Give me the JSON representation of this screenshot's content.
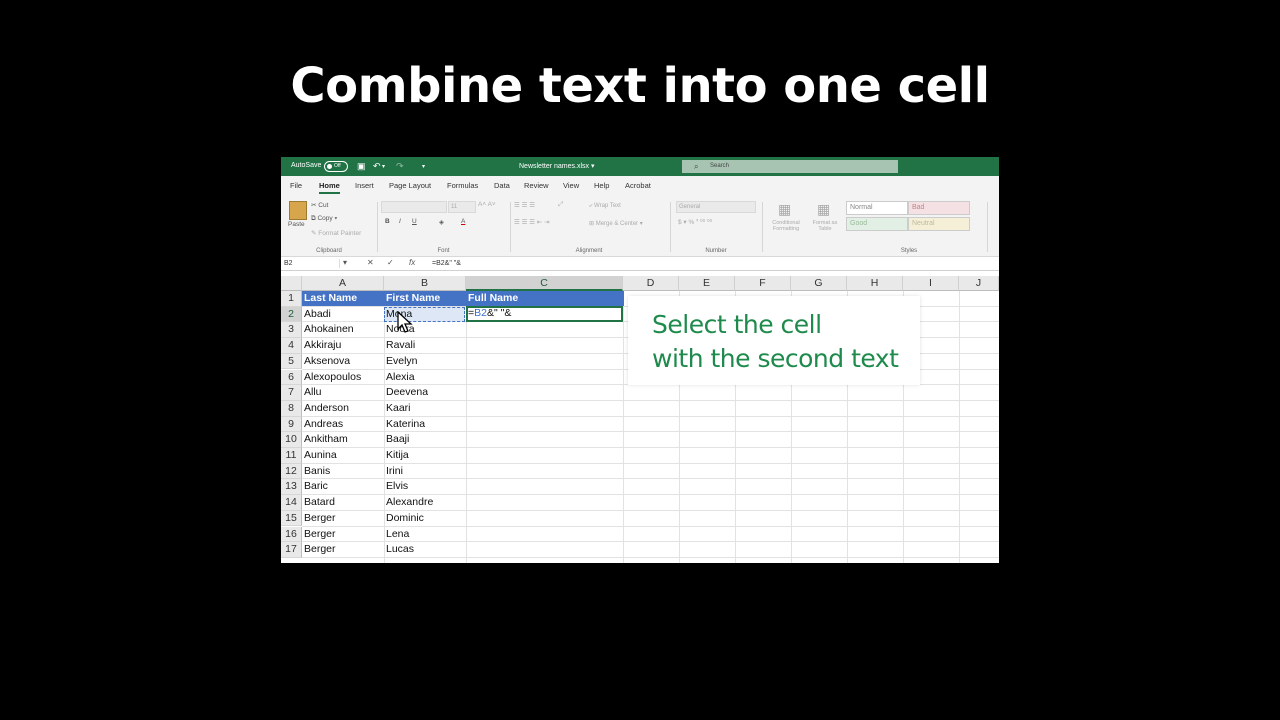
{
  "headline": "Combine text into one cell",
  "titlebar": {
    "autosave": "AutoSave",
    "toggle": "Off",
    "filename": "Newsletter names.xlsx ▾",
    "search_placeholder": "Search"
  },
  "menu": [
    "File",
    "Home",
    "Insert",
    "Page Layout",
    "Formulas",
    "Data",
    "Review",
    "View",
    "Help",
    "Acrobat"
  ],
  "ribbon": {
    "clipboard": {
      "paste": "Paste",
      "cut": "Cut",
      "copy": "Copy",
      "format_painter": "Format Painter",
      "label": "Clipboard"
    },
    "font": {
      "label": "Font",
      "size": "11"
    },
    "alignment": {
      "wrap": "Wrap Text",
      "merge": "Merge & Center",
      "label": "Alignment"
    },
    "number": {
      "format": "General",
      "label": "Number"
    },
    "conditional": "Conditional Formatting",
    "format_as_table": "Format as Table",
    "styles": {
      "normal": "Normal",
      "bad": "Bad",
      "good": "Good",
      "neutral": "Neutral",
      "label": "Styles"
    }
  },
  "formula_bar": {
    "name_box": "B2",
    "cancel": "✕",
    "enter": "✓",
    "fx": "fx",
    "formula": "=B2&\" \"&"
  },
  "columns": [
    "A",
    "B",
    "C",
    "D",
    "E",
    "F",
    "G",
    "H",
    "I",
    "J"
  ],
  "rows": [
    [
      "Last Name",
      "First Name",
      "Full Name"
    ],
    [
      "Abadi",
      "Mona",
      ""
    ],
    [
      "Ahokainen",
      "Noora",
      ""
    ],
    [
      "Akkiraju",
      "Ravali",
      ""
    ],
    [
      "Aksenova",
      "Evelyn",
      ""
    ],
    [
      "Alexopoulos",
      "Alexia",
      ""
    ],
    [
      "Allu",
      "Deevena",
      ""
    ],
    [
      "Anderson",
      "Kaari",
      ""
    ],
    [
      "Andreas",
      "Katerina",
      ""
    ],
    [
      "Ankitham",
      "Baaji",
      ""
    ],
    [
      "Aunina",
      "Kitija",
      ""
    ],
    [
      "Banis",
      "Irini",
      ""
    ],
    [
      "Baric",
      "Elvis",
      ""
    ],
    [
      "Batard",
      "Alexandre",
      ""
    ],
    [
      "Berger",
      "Dominic",
      ""
    ],
    [
      "Berger",
      "Lena",
      ""
    ],
    [
      "Berger",
      "Lucas",
      ""
    ]
  ],
  "edit_cell": {
    "prefix": "=",
    "ref": "B2",
    "rest": "&\" \"&"
  },
  "callout": {
    "line1": "Select the cell",
    "line2": "with the second text"
  },
  "colors": {
    "excel_green": "#217346",
    "header_blue": "#4472c4",
    "callout_green": "#1e8a4c"
  }
}
